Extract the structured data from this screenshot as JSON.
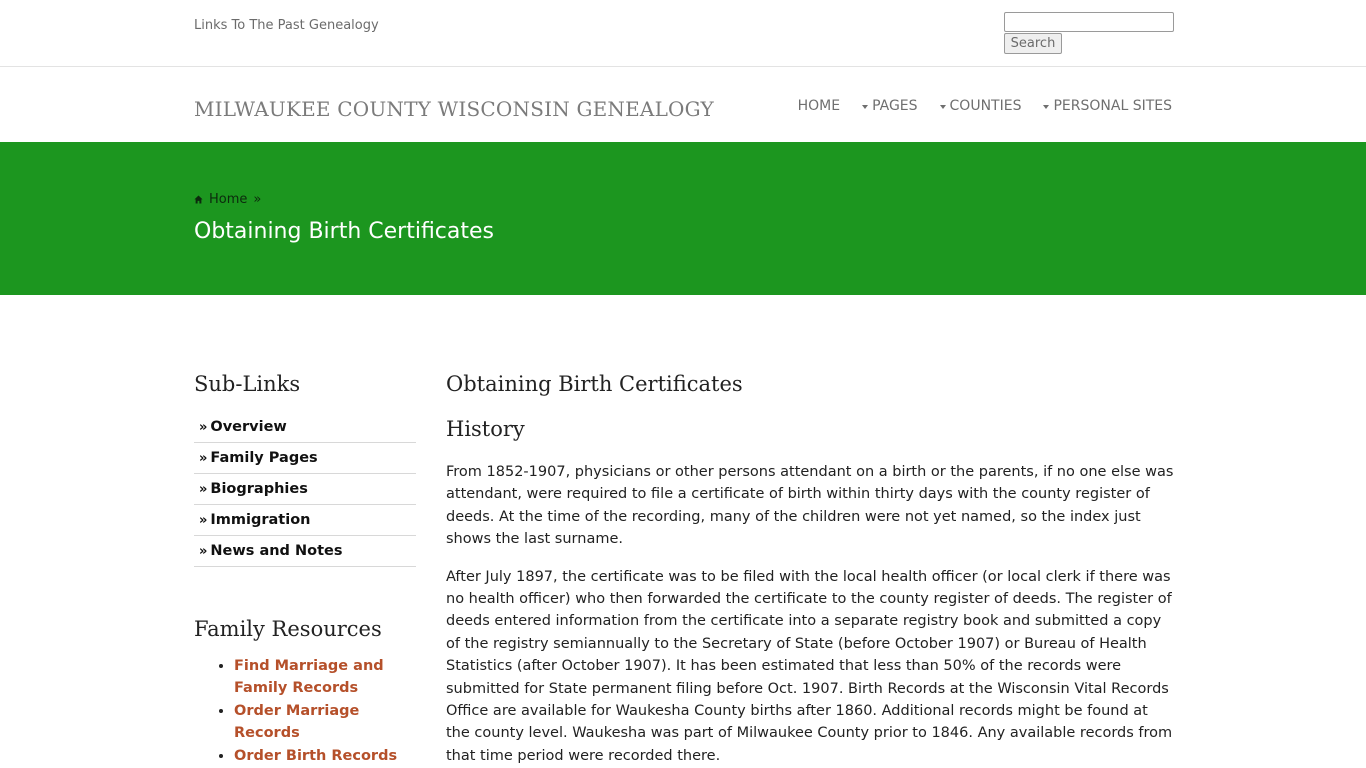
{
  "topbar": {
    "site_link": "Links To The Past Genealogy",
    "search_placeholder": "",
    "search_button": "Search"
  },
  "header": {
    "site_title": "MILWAUKEE COUNTY WISCONSIN GENEALOGY",
    "nav": [
      {
        "label": "HOME",
        "dropdown": false
      },
      {
        "label": "PAGES",
        "dropdown": true
      },
      {
        "label": "COUNTIES",
        "dropdown": true
      },
      {
        "label": "PERSONAL SITES",
        "dropdown": true
      }
    ]
  },
  "banner": {
    "breadcrumb_home": "Home",
    "breadcrumb_sep": "»",
    "title": "Obtaining Birth Certificates",
    "color": "#1c961f"
  },
  "sidebar": {
    "sublinks_heading": "Sub-Links",
    "sublinks": [
      {
        "label": "Overview"
      },
      {
        "label": "Family Pages"
      },
      {
        "label": "Biographies"
      },
      {
        "label": "Immigration"
      },
      {
        "label": "News and Notes"
      }
    ],
    "resources_heading": "Family Resources",
    "resources": [
      {
        "label": "Find Marriage and Family Records"
      },
      {
        "label": "Order Marriage Records"
      },
      {
        "label": "Order Birth Records"
      }
    ]
  },
  "main": {
    "title": "Obtaining Birth Certificates",
    "section_heading": "History",
    "paragraphs": [
      "From 1852-1907, physicians or other persons attendant on a birth or the parents, if no one else was attendant, were required to file a certificate of birth within thirty days with the county register of deeds. At the time of the recording, many of the children were not yet named, so the index just shows the last surname.",
      "After July 1897, the certificate was to be filed with the local health officer (or local clerk if there was no health officer) who then forwarded the certificate to the county register of deeds. The register of deeds entered information from the certificate into a separate registry book and submitted a copy of the registry semiannually to the Secretary of State (before October 1907) or Bureau of Health Statistics (after October 1907). It has been estimated that less than 50% of the records were submitted for State permanent filing before Oct. 1907. Birth Records at the Wisconsin Vital Records Office are available for Waukesha County births after 1860. Additional records might be found at the county level. Waukesha was part of Milwaukee County prior to 1846. Any available records from that time period were recorded there."
    ]
  },
  "colors": {
    "link_accent": "#b5502a",
    "banner_green": "#1c961f"
  }
}
